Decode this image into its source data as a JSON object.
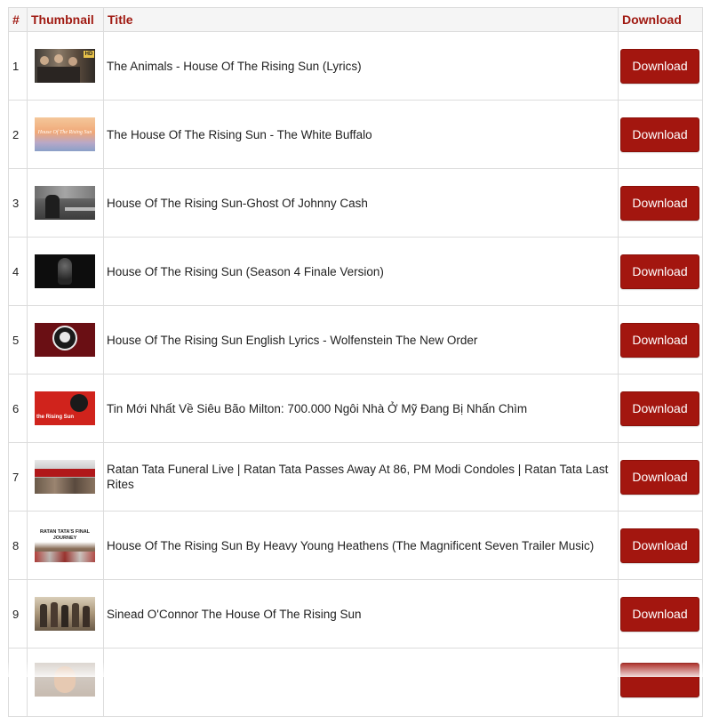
{
  "table": {
    "headers": {
      "num": "#",
      "thumbnail": "Thumbnail",
      "title": "Title",
      "download": "Download"
    },
    "rows": [
      {
        "num": "1",
        "title": "The Animals - House Of The Rising Sun (Lyrics)",
        "download": "Download",
        "thumb": "band-photo-thumbnail",
        "thumb_badge": "HD"
      },
      {
        "num": "2",
        "title": "The House Of The Rising Sun - The White Buffalo",
        "download": "Download",
        "thumb": "sunset-lyrics-thumbnail",
        "thumb_text": "House Of The Rising Sun"
      },
      {
        "num": "3",
        "title": "House Of The Rising Sun-Ghost Of Johnny Cash",
        "download": "Download",
        "thumb": "road-figure-thumbnail"
      },
      {
        "num": "4",
        "title": "House Of The Rising Sun (Season 4 Finale Version)",
        "download": "Download",
        "thumb": "dark-figure-thumbnail"
      },
      {
        "num": "5",
        "title": "House Of The Rising Sun English Lyrics - Wolfenstein The New Order",
        "download": "Download",
        "thumb": "skull-emblem-thumbnail"
      },
      {
        "num": "6",
        "title": "Tin Mới Nhất Về Siêu Bão Milton: 700.000 Ngôi Nhà Ở Mỹ Đang Bị Nhấn Chìm",
        "download": "Download",
        "thumb": "red-lyrics-thumbnail",
        "thumb_text": "the Rising Sun"
      },
      {
        "num": "7",
        "title": "Ratan Tata Funeral Live | Ratan Tata Passes Away At 86, PM Modi Condoles | Ratan Tata Last Rites",
        "download": "Download",
        "thumb": "news-crowd-thumbnail"
      },
      {
        "num": "8",
        "title": "House Of The Rising Sun By Heavy Young Heathens (The Magnificent Seven Trailer Music)",
        "download": "Download",
        "thumb": "final-journey-thumbnail",
        "thumb_text": "RATAN TATA'S FINAL JOURNEY"
      },
      {
        "num": "9",
        "title": "Sinead O'Connor The House Of The Rising Sun",
        "download": "Download",
        "thumb": "cowboys-thumbnail"
      },
      {
        "num": "",
        "title": "",
        "download": "",
        "thumb": "portrait-thumbnail"
      }
    ]
  },
  "colors": {
    "accent": "#a3160f",
    "header_text": "#a01a12",
    "border": "#dcdcdc"
  }
}
